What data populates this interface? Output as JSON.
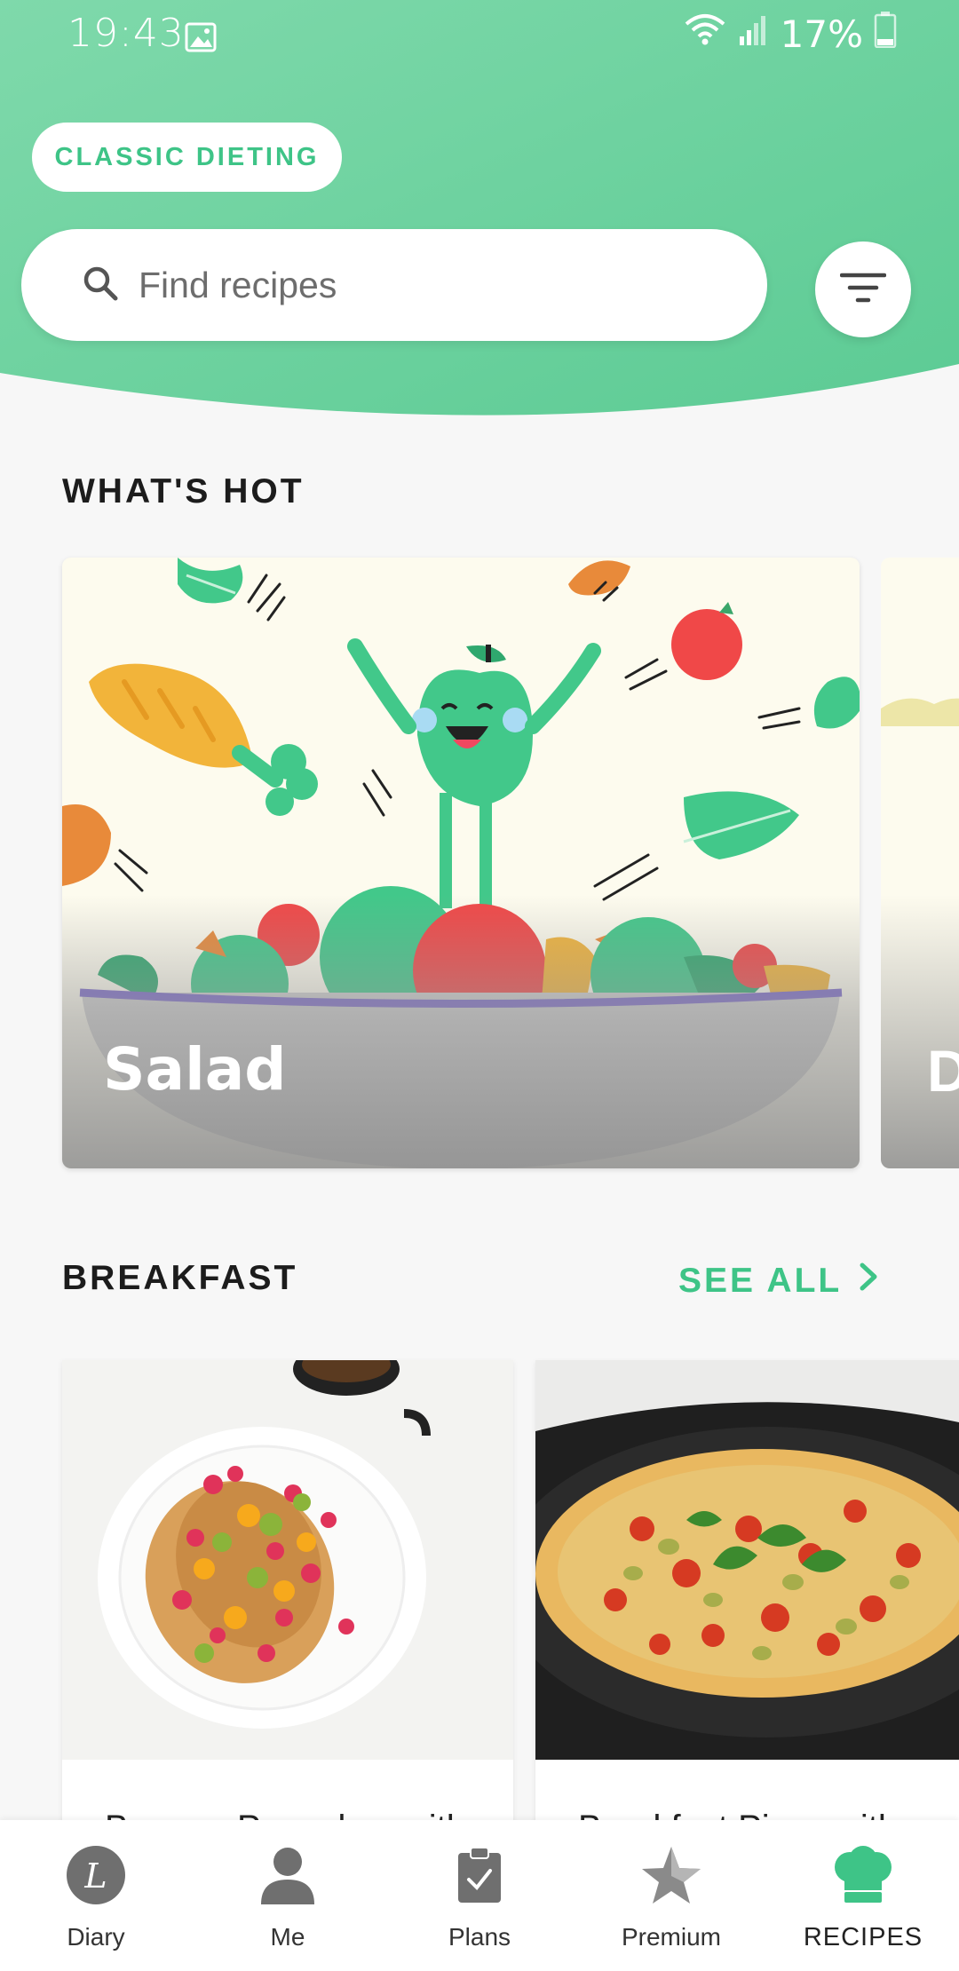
{
  "status_bar": {
    "time": "19:43",
    "battery": "17%",
    "icons": [
      "image-icon",
      "wifi-icon",
      "signal-icon",
      "battery-icon"
    ]
  },
  "header": {
    "diet_pill": "CLASSIC DIETING",
    "search_placeholder": "Find recipes",
    "filter_icon": "filter-icon"
  },
  "whats_hot": {
    "title": "WHAT'S HOT",
    "cards": [
      {
        "label": "Salad"
      },
      {
        "label": "D"
      }
    ]
  },
  "breakfast": {
    "title": "BREAKFAST",
    "see_all": "SEE ALL",
    "cards": [
      {
        "title": "Banana Pancakes with"
      },
      {
        "title": "Breakfast Pizza with"
      }
    ]
  },
  "bottom_nav": {
    "items": [
      {
        "label": "Diary",
        "icon": "diary-icon"
      },
      {
        "label": "Me",
        "icon": "person-icon"
      },
      {
        "label": "Plans",
        "icon": "clipboard-icon"
      },
      {
        "label": "Premium",
        "icon": "star-icon"
      },
      {
        "label": "RECIPES",
        "icon": "chef-hat-icon",
        "active": true
      }
    ]
  },
  "colors": {
    "accent": "#3ec487",
    "header_green": "#6dd3a0"
  }
}
